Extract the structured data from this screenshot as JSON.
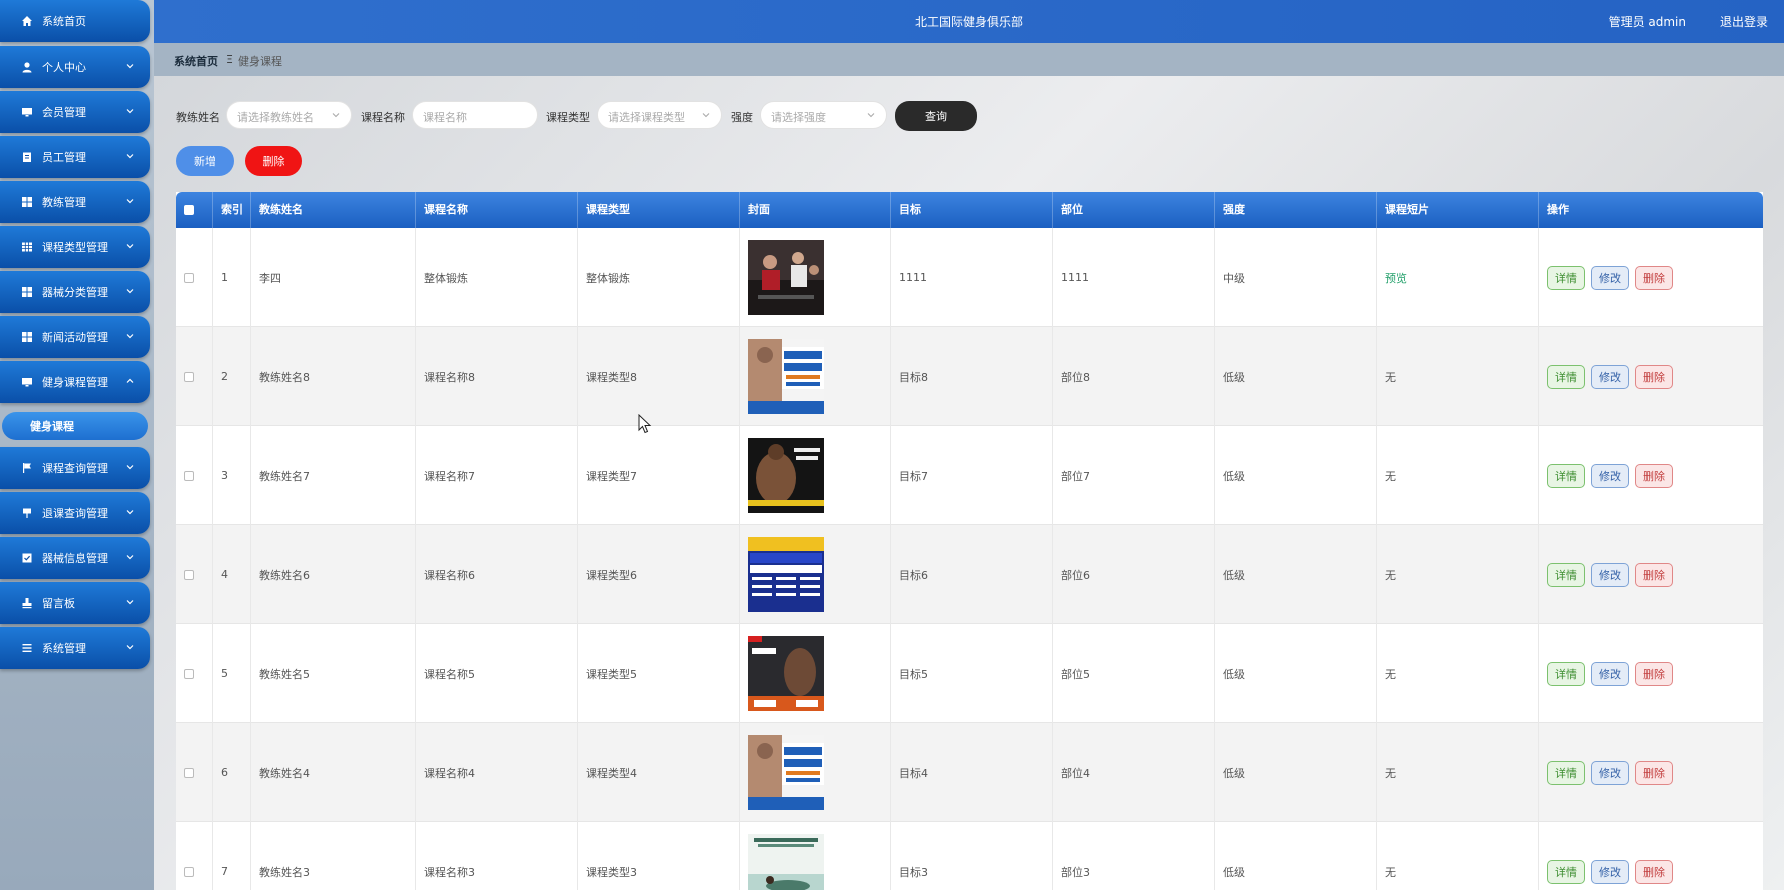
{
  "sidebar": {
    "items": [
      {
        "label": "系统首页",
        "icon": "home-icon"
      },
      {
        "label": "个人中心",
        "icon": "user-icon"
      },
      {
        "label": "会员管理",
        "icon": "monitor-icon"
      },
      {
        "label": "员工管理",
        "icon": "clipboard-icon"
      },
      {
        "label": "教练管理",
        "icon": "grid-icon"
      },
      {
        "label": "课程类型管理",
        "icon": "table-icon"
      },
      {
        "label": "器械分类管理",
        "icon": "grid-icon"
      },
      {
        "label": "新闻活动管理",
        "icon": "grid-icon"
      },
      {
        "label": "健身课程管理",
        "icon": "monitor-icon"
      },
      {
        "label": "课程查询管理",
        "icon": "flag-icon"
      },
      {
        "label": "退课查询管理",
        "icon": "pin-icon"
      },
      {
        "label": "器械信息管理",
        "icon": "checkbox-icon"
      },
      {
        "label": "留言板",
        "icon": "stamp-icon"
      },
      {
        "label": "系统管理",
        "icon": "list-icon"
      }
    ],
    "active_sub": "健身课程"
  },
  "header": {
    "site_title": "北工国际健身俱乐部",
    "admin_label": "管理员 admin",
    "logout_label": "退出登录"
  },
  "breadcrumb": {
    "home": "系统首页",
    "separator": "Ξ",
    "current": "健身课程"
  },
  "filters": {
    "coach_label": "教练姓名",
    "coach_placeholder": "请选择教练姓名",
    "course_label": "课程名称",
    "course_placeholder": "课程名称",
    "type_label": "课程类型",
    "type_placeholder": "请选择课程类型",
    "intensity_label": "强度",
    "intensity_placeholder": "请选择强度",
    "query_label": "查询"
  },
  "toolbar": {
    "add_label": "新增",
    "delete_label": "删除"
  },
  "table": {
    "columns": [
      "索引",
      "教练姓名",
      "课程名称",
      "课程类型",
      "封面",
      "目标",
      "部位",
      "强度",
      "课程短片",
      "操作"
    ],
    "actions": {
      "detail": "详情",
      "edit": "修改",
      "remove": "删除"
    },
    "rows": [
      {
        "index": "1",
        "coach": "李四",
        "course": "整体锻炼",
        "type": "整体锻炼",
        "cover": "group-cycling-photo",
        "goal": "1111",
        "part": "1111",
        "intensity": "中级",
        "video": "预览"
      },
      {
        "index": "2",
        "coach": "教练姓名8",
        "course": "课程名称8",
        "type": "课程类型8",
        "cover": "fitness-course-poster",
        "goal": "目标8",
        "part": "部位8",
        "intensity": "低级",
        "video": "无"
      },
      {
        "index": "3",
        "coach": "教练姓名7",
        "course": "课程名称7",
        "type": "课程类型7",
        "cover": "muscle-man-poster",
        "goal": "目标7",
        "part": "部位7",
        "intensity": "低级",
        "video": "无"
      },
      {
        "index": "4",
        "coach": "教练姓名6",
        "course": "课程名称6",
        "type": "课程类型6",
        "cover": "certification-poster",
        "goal": "目标6",
        "part": "部位6",
        "intensity": "低级",
        "video": "无"
      },
      {
        "index": "5",
        "coach": "教练姓名5",
        "course": "课程名称5",
        "type": "课程类型5",
        "cover": "private-class-poster",
        "goal": "目标5",
        "part": "部位5",
        "intensity": "低级",
        "video": "无"
      },
      {
        "index": "6",
        "coach": "教练姓名4",
        "course": "课程名称4",
        "type": "课程类型4",
        "cover": "fitness-course-poster",
        "goal": "目标4",
        "part": "部位4",
        "intensity": "低级",
        "video": "无"
      },
      {
        "index": "7",
        "coach": "教练姓名3",
        "course": "课程名称3",
        "type": "课程类型3",
        "cover": "yoga-poster",
        "goal": "目标3",
        "part": "部位3",
        "intensity": "低级",
        "video": "无"
      }
    ]
  },
  "colors": {
    "header_blue": "#2563c4",
    "menu_blue": "#0a4fa8",
    "delete_red": "#f01414",
    "add_blue": "#4f8fe8",
    "query_dark": "#2a2a2a"
  }
}
